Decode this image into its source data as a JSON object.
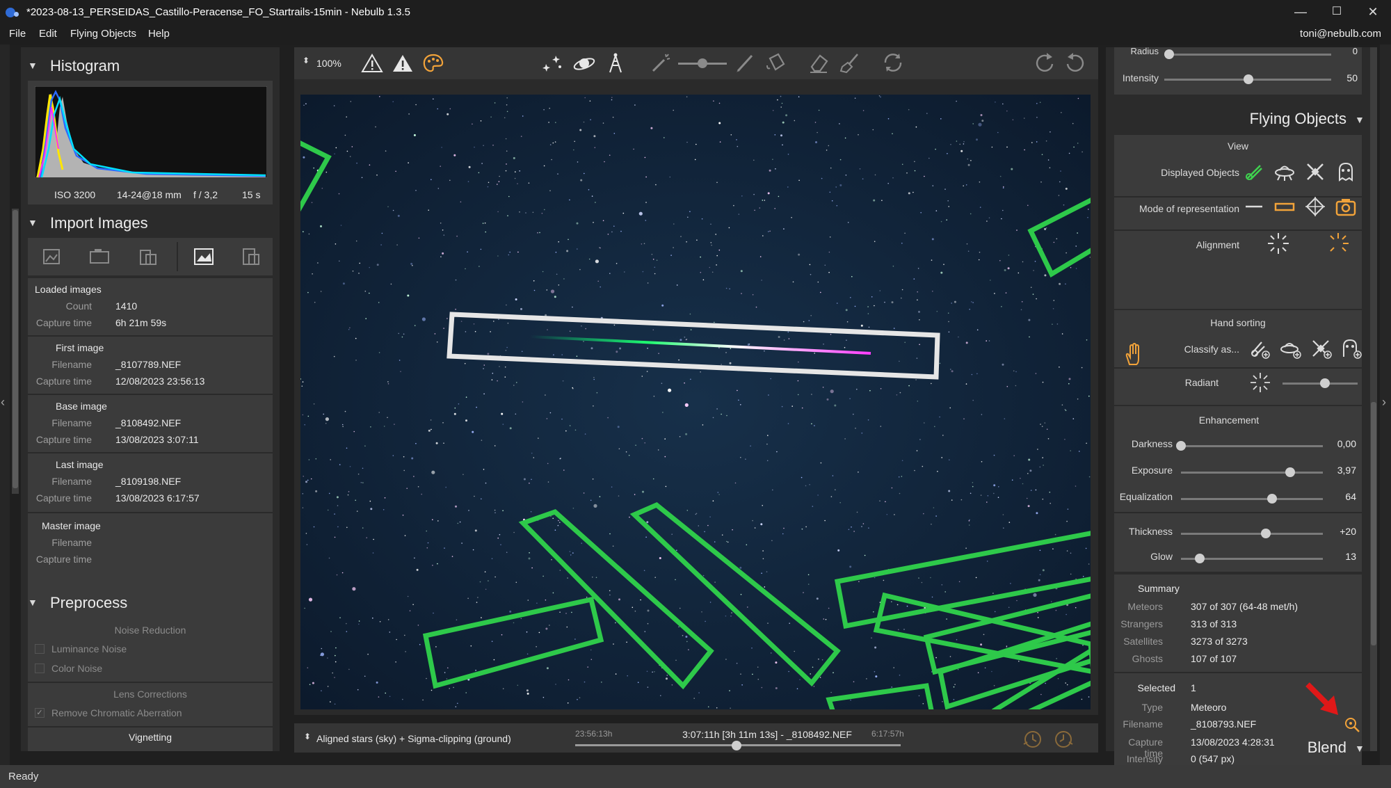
{
  "window": {
    "title": "*2023-08-13_PERSEIDAS_Castillo-Peracense_FO_Startrails-15min - Nebulb 1.3.5",
    "minimize": "—",
    "maximize": "☐",
    "close": "✕"
  },
  "menu": {
    "items": [
      "File",
      "Edit",
      "Flying Objects",
      "Help"
    ],
    "user": "toni@nebulb.com"
  },
  "histogram": {
    "title": "Histogram",
    "iso": "ISO 3200",
    "lens": "14-24@18 mm",
    "aperture": "f / 3,2",
    "exposure": "15 s"
  },
  "import": {
    "title": "Import Images",
    "loaded": {
      "title": "Loaded images",
      "count_label": "Count",
      "count": "1410",
      "capture_label": "Capture time",
      "capture": "6h 21m 59s"
    },
    "first": {
      "title": "First image",
      "filename_label": "Filename",
      "filename": "_8107789.NEF",
      "capture_label": "Capture time",
      "capture": "12/08/2023 23:56:13"
    },
    "base": {
      "title": "Base image",
      "filename_label": "Filename",
      "filename": "_8108492.NEF",
      "capture_label": "Capture time",
      "capture": "13/08/2023 3:07:11"
    },
    "last": {
      "title": "Last image",
      "filename_label": "Filename",
      "filename": "_8109198.NEF",
      "capture_label": "Capture time",
      "capture": "13/08/2023 6:17:57"
    },
    "master": {
      "title": "Master image",
      "filename_label": "Filename",
      "capture_label": "Capture time"
    }
  },
  "preprocess": {
    "title": "Preprocess",
    "noise_title": "Noise Reduction",
    "luminance": "Luminance Noise",
    "color": "Color Noise",
    "lens_title": "Lens Corrections",
    "chromatic": "Remove Chromatic Aberration",
    "vignetting": "Vignetting"
  },
  "toolbar": {
    "zoom": "100%"
  },
  "bottombar": {
    "mode": "Aligned stars (sky) + Sigma-clipping (ground)",
    "start_time": "23:56:13h",
    "current": "3:07:11h [3h 11m 13s] - _8108492.NEF",
    "end_time": "6:17:57h",
    "position": 0.495
  },
  "right": {
    "radius_label": "Radius",
    "radius_value": "0",
    "intensity_label": "Intensity",
    "intensity_value": "50",
    "flying_title": "Flying Objects",
    "view_title": "View",
    "displayed_label": "Displayed Objects",
    "mode_label": "Mode of representation",
    "alignment_label": "Alignment",
    "hand_title": "Hand sorting",
    "classify_label": "Classify as...",
    "radiant_label": "Radiant",
    "enh_title": "Enhancement",
    "darkness_label": "Darkness",
    "darkness_value": "0,00",
    "darkness_pos": 0.0,
    "exposure_label": "Exposure",
    "exposure_value": "3,97",
    "exposure_pos": 0.77,
    "equal_label": "Equalization",
    "equal_value": "64",
    "equal_pos": 0.64,
    "thick_label": "Thickness",
    "thick_value": "+20",
    "thick_pos": 0.6,
    "glow_label": "Glow",
    "glow_value": "13",
    "glow_pos": 0.13,
    "summary_title": "Summary",
    "meteors_label": "Meteors",
    "meteors": "307 of 307 (64-48 met/h)",
    "strangers_label": "Strangers",
    "strangers": "313 of 313",
    "satellites_label": "Satellites",
    "satellites": "3273 of 3273",
    "ghosts_label": "Ghosts",
    "ghosts": "107 of 107",
    "selected_label": "Selected",
    "selected": "1",
    "type_label": "Type",
    "type": "Meteoro",
    "filename_label": "Filename",
    "filename": "_8108793.NEF",
    "capture_label": "Capture time",
    "capture": "13/08/2023 4:28:31",
    "intensity2_label": "Intensity",
    "intensity2": "0 (547 px)",
    "blend_title": "Blend"
  },
  "status": "Ready",
  "colors": {
    "accent": "#f2a33a",
    "green": "#3fd24f",
    "red": "#e01818",
    "detect": "#2ec94a"
  }
}
